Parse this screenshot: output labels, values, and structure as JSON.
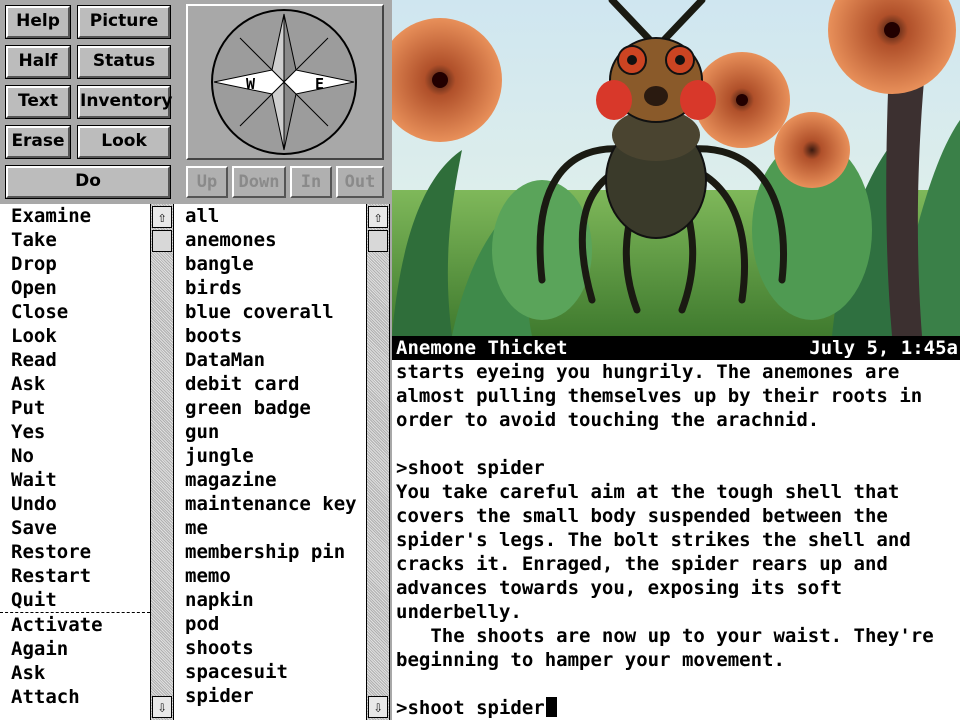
{
  "buttons": {
    "help": "Help",
    "picture": "Picture",
    "half": "Half",
    "status": "Status",
    "text": "Text",
    "inventory": "Inventory",
    "erase": "Erase",
    "look": "Look",
    "do": "Do"
  },
  "compass": {
    "west": "W",
    "east": "E"
  },
  "directions": {
    "up": "Up",
    "down": "Down",
    "in": "In",
    "out": "Out"
  },
  "verbs": [
    "Examine",
    "Take",
    "Drop",
    "Open",
    "Close",
    "Look",
    "Read",
    "Ask",
    "Put",
    "Yes",
    "No",
    "Wait",
    "Undo",
    "Save",
    "Restore",
    "Restart",
    "Quit",
    "Activate",
    "Again",
    "Ask",
    "Attach"
  ],
  "nouns": [
    "all",
    "anemones",
    "bangle",
    "birds",
    "blue coverall",
    "boots",
    "DataMan",
    "debit card",
    "green badge",
    "gun",
    "jungle",
    "magazine",
    "maintenance key",
    "me",
    "membership pin",
    "memo",
    "napkin",
    "pod",
    "shoots",
    "spacesuit",
    "spider"
  ],
  "status_bar": {
    "location": "Anemone Thicket",
    "time": "July 5, 1:45a"
  },
  "output_lines": [
    "starts eyeing you hungrily. The anemones are",
    "almost pulling themselves up by their roots in",
    "order to avoid touching the arachnid.",
    "",
    ">shoot spider",
    "You take careful aim at the tough shell that",
    "covers the small body suspended between the",
    "spider's legs. The bolt strikes the shell and",
    "cracks it. Enraged, the spider rears up and",
    "advances towards you, exposing its soft",
    "underbelly.",
    "   The shoots are now up to your waist. They're",
    "beginning to hamper your movement.",
    ""
  ],
  "input_line": ">shoot spider",
  "scroll_icons": {
    "up": "⇧",
    "down": "⇩"
  },
  "colors": {
    "panel": "#a8a8a8",
    "status_bar": "#000000",
    "text_bg": "#ffffff"
  }
}
